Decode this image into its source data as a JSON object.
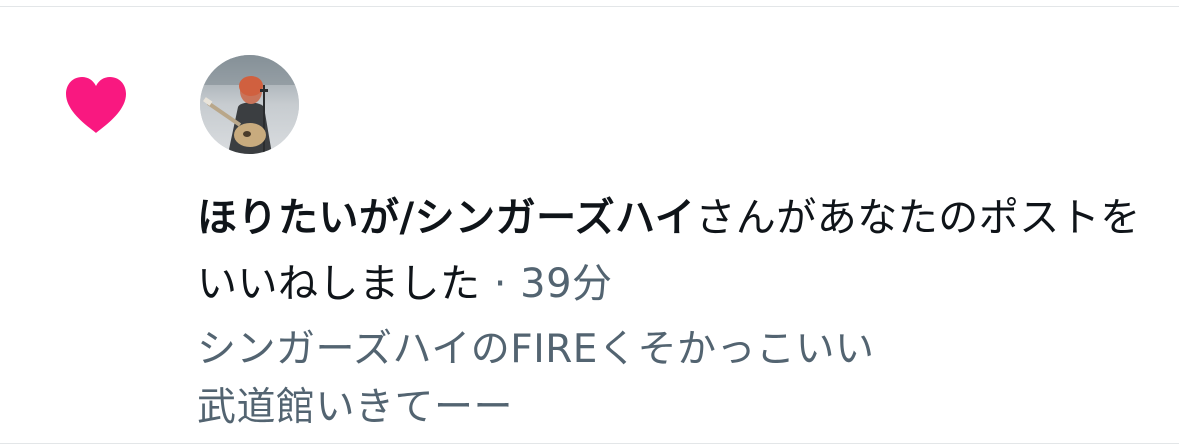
{
  "notification": {
    "type_icon": "heart-icon",
    "type_icon_color": "#f91880",
    "avatar_icon": "avatar-photo",
    "username": "ほりたいが/シンガーズハイ",
    "action_text": "さんがあなたのポストをいいねしました",
    "separator": " · ",
    "time_ago": "39分",
    "post_lines": [
      "シンガーズハイのFIREくそかっこいい",
      "武道館いきてーー"
    ]
  },
  "colors": {
    "primary_text": "#0f1419",
    "secondary_text": "#536471",
    "divider": "#e3e6e8",
    "like": "#f91880"
  }
}
